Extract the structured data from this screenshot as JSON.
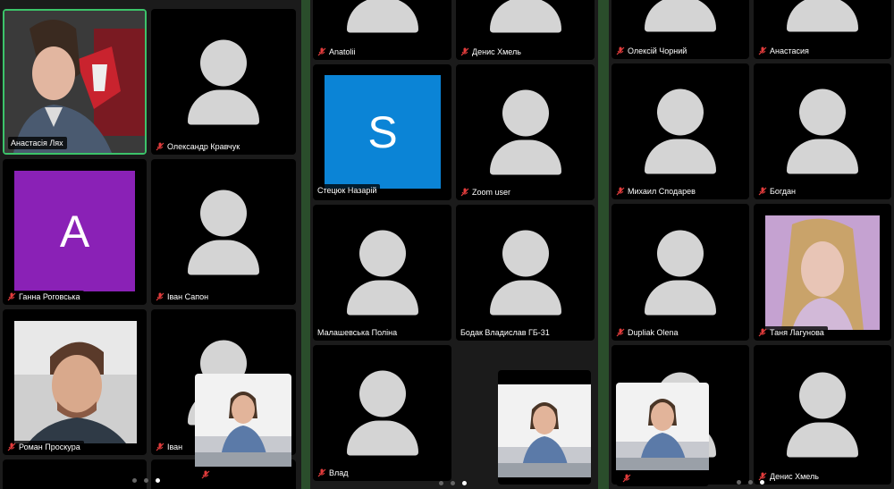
{
  "panels": [
    {
      "tiles": [
        {
          "name": "Анастасія Лях",
          "type": "photo-woman-red",
          "muted": false,
          "active": true
        },
        {
          "name": "Олександр Кравчук",
          "type": "avatar",
          "muted": true
        },
        {
          "name": "Ганна Роговська",
          "type": "letter",
          "letter": "A",
          "color": "#8a21b6",
          "muted": true
        },
        {
          "name": "Іван Сапон",
          "type": "avatar",
          "muted": true
        },
        {
          "name": "Роман Проскура",
          "type": "photo-man",
          "muted": true
        },
        {
          "name": "Іван",
          "type": "avatar",
          "muted": true
        }
      ],
      "page_dots": 3,
      "active_dot": 2
    },
    {
      "tiles": [
        {
          "name": "Anatolii",
          "type": "avatar",
          "muted": true
        },
        {
          "name": "Денис Хмель",
          "type": "avatar",
          "muted": true
        },
        {
          "name": "Стецюк Назарій",
          "type": "letter",
          "letter": "S",
          "color": "#0b84d6",
          "muted": false
        },
        {
          "name": "Zoom user",
          "type": "avatar",
          "muted": true
        },
        {
          "name": "Малашевська Поліна",
          "type": "avatar",
          "muted": false
        },
        {
          "name": "Бодак Владислав ГБ-31",
          "type": "avatar",
          "muted": false
        },
        {
          "name": "Влад",
          "type": "avatar",
          "muted": true
        }
      ],
      "page_dots": 3,
      "active_dot": 2
    },
    {
      "tiles": [
        {
          "name": "Олексій Чорний",
          "type": "avatar",
          "muted": true
        },
        {
          "name": "Анастасия",
          "type": "avatar",
          "muted": true
        },
        {
          "name": "Михаил Сподарев",
          "type": "avatar",
          "muted": true
        },
        {
          "name": "Богдан",
          "type": "avatar",
          "muted": true
        },
        {
          "name": "Dupliak Olena",
          "type": "avatar",
          "muted": true
        },
        {
          "name": "Таня Лагунова",
          "type": "photo-girl",
          "muted": true
        },
        {
          "name": "",
          "type": "avatar",
          "muted": false
        },
        {
          "name": "Денис Хмель",
          "type": "avatar",
          "muted": true
        }
      ],
      "page_dots": 3,
      "active_dot": 2
    }
  ],
  "self_view": {
    "muted": true
  }
}
